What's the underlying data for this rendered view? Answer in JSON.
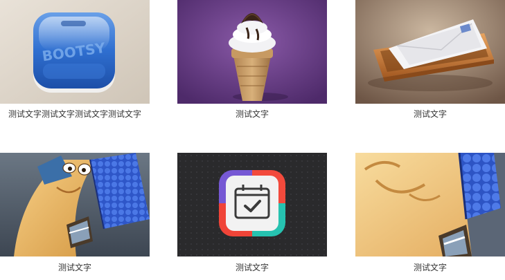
{
  "gallery": {
    "items": [
      {
        "caption": "测试文字测试文字测试文字测试文字",
        "image": "blue-bootsy-app-icon",
        "badge_text": "BOOTSY"
      },
      {
        "caption": "测试文字",
        "image": "soft-serve-ice-cream-cone-icon",
        "badge_text": ""
      },
      {
        "caption": "测试文字",
        "image": "wooden-mail-tray-envelopes-icon",
        "badge_text": ""
      },
      {
        "caption": "测试文字",
        "image": "cartoon-house-character-icon",
        "badge_text": ""
      },
      {
        "caption": "测试文字",
        "image": "calendar-checkmark-app-icon",
        "badge_text": ""
      },
      {
        "caption": "测试文字",
        "image": "house-character-closeup-icon",
        "badge_text": ""
      }
    ]
  },
  "colors": {
    "caption_text": "#333333",
    "page_background": "#ffffff"
  }
}
